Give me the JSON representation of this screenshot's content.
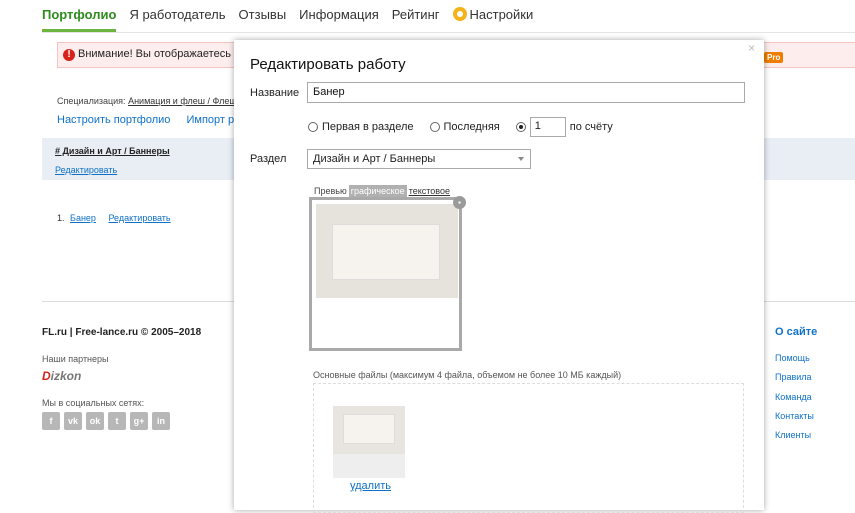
{
  "nav": {
    "items": [
      {
        "label": "Портфолио",
        "active": true
      },
      {
        "label": "Я работодатель"
      },
      {
        "label": "Отзывы"
      },
      {
        "label": "Информация"
      },
      {
        "label": "Рейтинг"
      },
      {
        "label": "Настройки",
        "icon": "gear-icon"
      }
    ]
  },
  "warning": {
    "icon": "exclamation-icon",
    "text": "Внимание! Вы отображаетесь в кат",
    "badge": "Pro"
  },
  "portfolio": {
    "spec_label": "Специализация:",
    "spec_value": "Анимация и флеш / Флеш-бан",
    "setup_link": "Настроить портфолио",
    "import_link": "Импорт работ",
    "category_title": "#   Дизайн и Арт / Баннеры",
    "category_edit": "Редактировать",
    "item_number": "1.",
    "item_title": "Банер",
    "item_edit": "Редактировать"
  },
  "footer": {
    "copyright": "FL.ru | Free-lance.ru © 2005–2018",
    "partners_label": "Наши партнеры",
    "partner_logo": "Dizkon",
    "social_label": "Мы в социальных сетях:",
    "social_icons": [
      "facebook-icon",
      "vk-icon",
      "ok-icon",
      "twitter-icon",
      "googleplus-icon",
      "linkedin-icon"
    ],
    "about_title": "О сайте",
    "about_links": [
      "Помощь",
      "Правила",
      "Команда",
      "Контакты",
      "Клиенты"
    ]
  },
  "modal": {
    "title": "Редактировать работу",
    "close": "×",
    "name_label": "Название",
    "name_value": "Банер",
    "radio_first": "Первая в разделе",
    "radio_last": "Последняя",
    "position_value": "1",
    "position_suffix": "по счёту",
    "section_label": "Раздел",
    "section_value": "Дизайн и Арт / Баннеры",
    "preview_label": "Превью",
    "tab_graphic": "графическое",
    "tab_text": "текстовое",
    "files_label": "Основные файлы (максимум 4 файла, объемом не более 10 МБ каждый)",
    "delete_link": "удалить"
  },
  "colors": {
    "accent_green": "#2e8b1e",
    "link_blue": "#0f71c8",
    "warning_red": "#d6231c",
    "pro_orange": "#f07d00"
  }
}
